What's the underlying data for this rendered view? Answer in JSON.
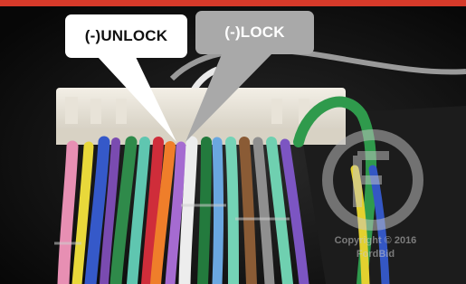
{
  "colors": {
    "header_bar": "#d63a2a",
    "unlock_callout": "#ffffff",
    "lock_callout": "#a9a9a9",
    "background": "#141414"
  },
  "callouts": {
    "unlock": {
      "label": "(-)UNLOCK"
    },
    "lock": {
      "label": "(-)LOCK"
    }
  },
  "watermark": {
    "icon": "gear-logo-icon",
    "line1": "Copyright © 2016",
    "line2": "FordBid"
  }
}
